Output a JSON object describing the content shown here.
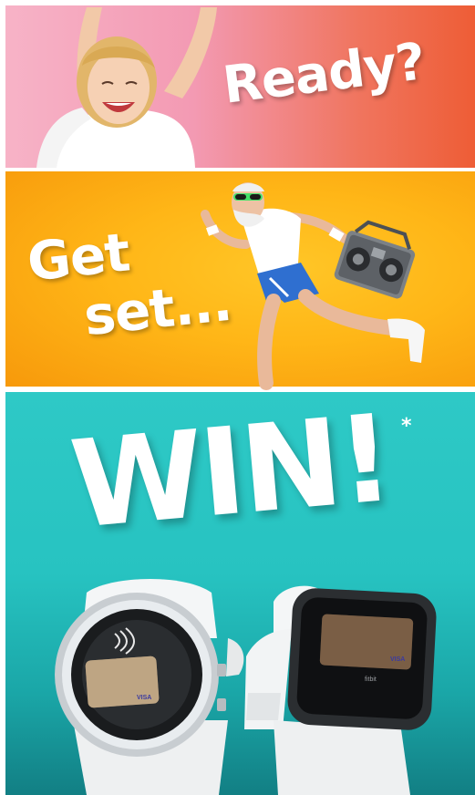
{
  "panels": {
    "ready": {
      "headline": "Ready?"
    },
    "get_set": {
      "line1": "Get",
      "line2": "set..."
    },
    "win": {
      "headline": "WIN!",
      "footnote_mark": "*"
    }
  },
  "watches": {
    "left": {
      "card_brand": "VISA"
    },
    "right": {
      "card_brand": "VISA",
      "brand": "fitbit"
    }
  },
  "colors": {
    "ready_bg": "#f0755f",
    "getset_bg": "#ffb617",
    "win_bg": "#27c3c1",
    "headline": "#ffffff"
  }
}
